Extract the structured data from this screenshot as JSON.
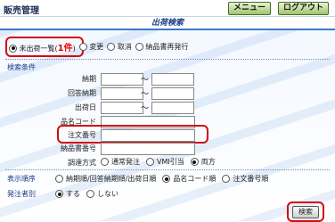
{
  "app": {
    "title": "販売管理"
  },
  "header": {
    "menu_label": "メニュー",
    "logout_label": "ログアウト"
  },
  "page": {
    "title": "出荷検索"
  },
  "modes": [
    {
      "label": "未出荷一覧(",
      "count": "1件",
      "close": ")",
      "selected": true
    },
    {
      "label": "変更",
      "selected": false
    },
    {
      "label": "取消",
      "selected": false
    },
    {
      "label": "納品書再発行",
      "selected": false
    }
  ],
  "search": {
    "section_title": "検索条件",
    "fields": {
      "delivery_date": "納期",
      "answer_date": "回答納期",
      "ship_date": "出荷日",
      "product_code": "品名コード",
      "order_no": "注文番号",
      "delivery_note_no": "納品書番号",
      "arrangement": "調達方式"
    },
    "tilde": "〜",
    "arrangement_options": [
      {
        "label": "通常発注",
        "selected": false
      },
      {
        "label": "VMI引当",
        "selected": false
      },
      {
        "label": "両方",
        "selected": true
      }
    ]
  },
  "sort": {
    "label": "表示順序",
    "options": [
      {
        "label": "納期順/回答納期順/出荷日順",
        "selected": false
      },
      {
        "label": "品名コード順",
        "selected": true
      },
      {
        "label": "注文番号順",
        "selected": false
      }
    ]
  },
  "order_by": {
    "label": "発注者別",
    "options": [
      {
        "label": "する",
        "selected": true
      },
      {
        "label": "しない",
        "selected": false
      }
    ]
  },
  "search_button": "検索"
}
